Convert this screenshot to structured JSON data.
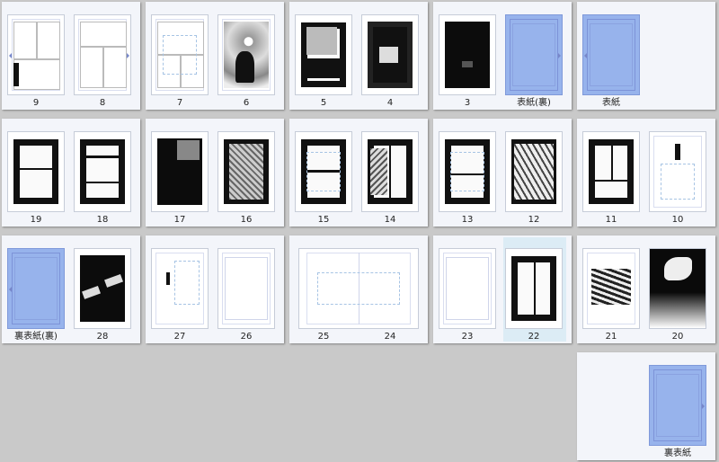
{
  "page_labels": {
    "p9": "9",
    "p8": "8",
    "p7": "7",
    "p6": "6",
    "p5": "5",
    "p4": "4",
    "p3": "3",
    "cover_back_inner": "表紙(裏)",
    "cover": "表紙",
    "p19": "19",
    "p18": "18",
    "p17": "17",
    "p16": "16",
    "p15": "15",
    "p14": "14",
    "p13": "13",
    "p12": "12",
    "p11": "11",
    "p10": "10",
    "back_cover_inner": "裏表紙(裏)",
    "p28": "28",
    "p27": "27",
    "p26": "26",
    "p25": "25",
    "p24": "24",
    "p23": "23",
    "p22": "22",
    "p21": "21",
    "p20": "20",
    "back_cover": "裏表紙"
  },
  "selected_page": "22",
  "colors": {
    "workspace_bg": "#c9c9c9",
    "spread_bg": "#f3f5fa",
    "selected_bg": "#dcecf5",
    "blank_page_blue": "#97b3ec"
  }
}
